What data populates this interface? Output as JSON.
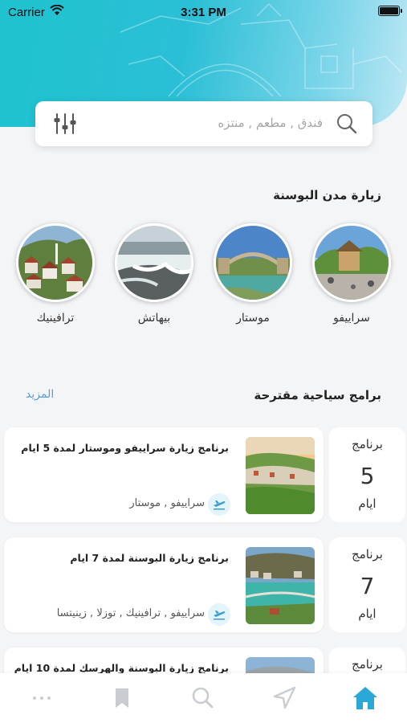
{
  "status_bar": {
    "carrier": "Carrier",
    "time": "3:31 PM"
  },
  "search": {
    "placeholder": "فندق , مطعم , منتزه"
  },
  "cities_section": {
    "title": "زيارة مدن البوسنة",
    "cities": [
      {
        "name": "سراييفو"
      },
      {
        "name": "موستار"
      },
      {
        "name": "بيهاتش"
      },
      {
        "name": "ترافينيك"
      }
    ]
  },
  "programs_section": {
    "title": "برامج سياحية مقترحة",
    "more_label": "المزيد",
    "programs": [
      {
        "title": "برنامج زيارة سراييفو وموستار لمدة 5 ايام",
        "cities": "سراييفو , موستار",
        "days_label": "برنامج",
        "days": "5",
        "days_unit": "ايام"
      },
      {
        "title": "برنامج زيارة البوسنة لمدة 7 ايام",
        "cities": "سراييفو , ترافينيك , توزلا , زينيتسا",
        "days_label": "برنامج",
        "days": "7",
        "days_unit": "ايام"
      },
      {
        "title": "برنامج زيارة البوسنة والهرسك لمدة 10 ايام",
        "cities": "",
        "days_label": "برنامج",
        "days": "",
        "days_unit": ""
      }
    ]
  },
  "tabbar": {
    "active_tab": "home",
    "active_color": "#2aa8d8",
    "inactive_color": "#c9cdd2",
    "tabs": [
      "more-icon",
      "bookmark-icon",
      "search-icon",
      "navigation-icon",
      "home-icon"
    ]
  }
}
